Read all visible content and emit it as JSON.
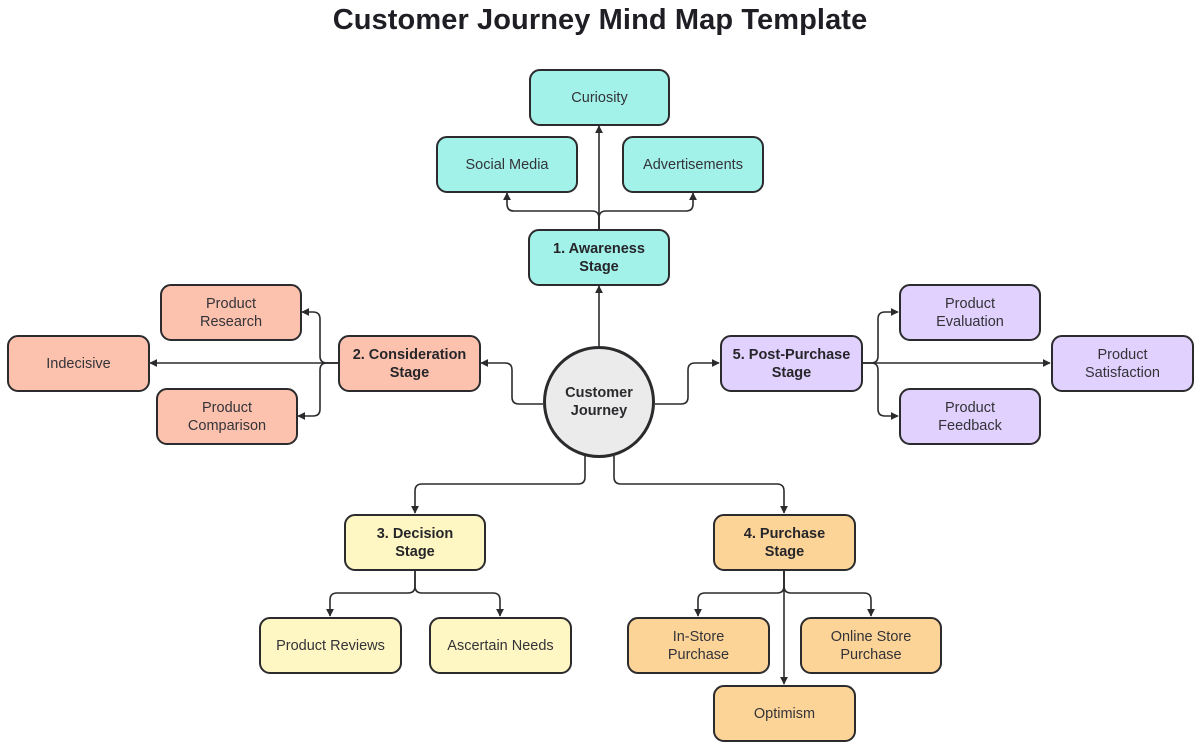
{
  "title": "Customer Journey Mind Map Template",
  "colors": {
    "awareness": "#a3f2ea",
    "consideration": "#fdc2ae",
    "decision": "#fef7c3",
    "purchase": "#fdd498",
    "post_purchase": "#e1d1fe",
    "hub": "#ebebeb",
    "stroke": "#2b2b2e"
  },
  "hub": {
    "line1": "Customer",
    "line2": "Journey"
  },
  "stages": {
    "awareness": {
      "label1": "1. Awareness",
      "label2": "Stage",
      "children": [
        {
          "line1": "Curiosity"
        },
        {
          "line1": "Social Media"
        },
        {
          "line1": "Advertisements"
        }
      ]
    },
    "consideration": {
      "label1": "2. Consideration",
      "label2": "Stage",
      "children": [
        {
          "line1": "Product",
          "line2": "Research"
        },
        {
          "line1": "Indecisive"
        },
        {
          "line1": "Product",
          "line2": "Comparison"
        }
      ]
    },
    "decision": {
      "label1": "3. Decision",
      "label2": "Stage",
      "children": [
        {
          "line1": "Product Reviews"
        },
        {
          "line1": "Ascertain Needs"
        }
      ]
    },
    "purchase": {
      "label1": "4. Purchase",
      "label2": "Stage",
      "children": [
        {
          "line1": "In-Store",
          "line2": "Purchase"
        },
        {
          "line1": "Online Store",
          "line2": "Purchase"
        },
        {
          "line1": "Optimism"
        }
      ]
    },
    "post_purchase": {
      "label1": "5. Post-Purchase",
      "label2": "Stage",
      "children": [
        {
          "line1": "Product",
          "line2": "Evaluation"
        },
        {
          "line1": "Product",
          "line2": "Satisfaction"
        },
        {
          "line1": "Product",
          "line2": "Feedback"
        }
      ]
    }
  }
}
